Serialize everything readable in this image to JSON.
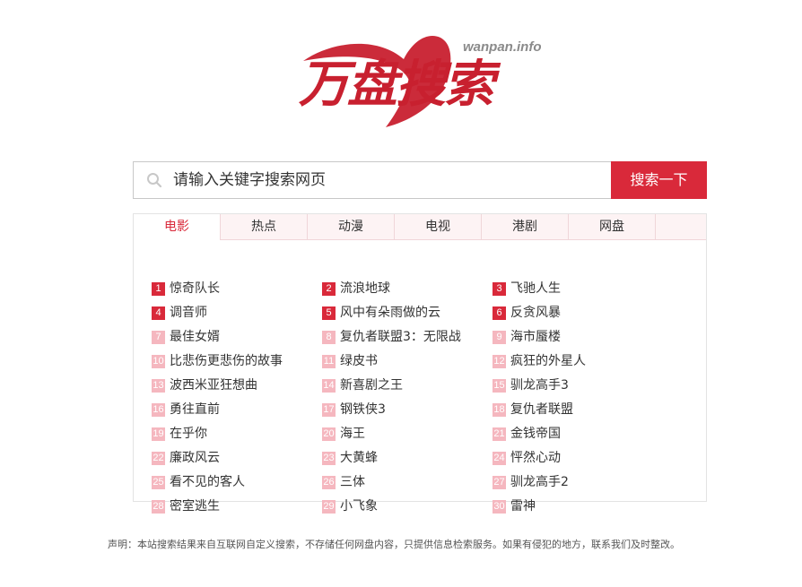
{
  "logo": {
    "domain": "wanpan.info",
    "title": "万盘搜索"
  },
  "search": {
    "placeholder": "请输入关键字搜索网页",
    "button": "搜索一下"
  },
  "tabs": [
    {
      "label": "电影",
      "active": true
    },
    {
      "label": "热点",
      "active": false
    },
    {
      "label": "动漫",
      "active": false
    },
    {
      "label": "电视",
      "active": false
    },
    {
      "label": "港剧",
      "active": false
    },
    {
      "label": "网盘",
      "active": false
    }
  ],
  "items": [
    {
      "rank": "1",
      "title": "惊奇队长"
    },
    {
      "rank": "2",
      "title": "流浪地球"
    },
    {
      "rank": "3",
      "title": "飞驰人生"
    },
    {
      "rank": "4",
      "title": "调音师"
    },
    {
      "rank": "5",
      "title": "风中有朵雨做的云"
    },
    {
      "rank": "6",
      "title": "反贪风暴"
    },
    {
      "rank": "7",
      "title": "最佳女婿"
    },
    {
      "rank": "8",
      "title": "复仇者联盟3：无限战"
    },
    {
      "rank": "9",
      "title": "海市蜃楼"
    },
    {
      "rank": "10",
      "title": "比悲伤更悲伤的故事"
    },
    {
      "rank": "11",
      "title": "绿皮书"
    },
    {
      "rank": "12",
      "title": "疯狂的外星人"
    },
    {
      "rank": "13",
      "title": "波西米亚狂想曲"
    },
    {
      "rank": "14",
      "title": "新喜剧之王"
    },
    {
      "rank": "15",
      "title": "驯龙高手3"
    },
    {
      "rank": "16",
      "title": "勇往直前"
    },
    {
      "rank": "17",
      "title": "钢铁侠3"
    },
    {
      "rank": "18",
      "title": "复仇者联盟"
    },
    {
      "rank": "19",
      "title": "在乎你"
    },
    {
      "rank": "20",
      "title": "海王"
    },
    {
      "rank": "21",
      "title": "金钱帝国"
    },
    {
      "rank": "22",
      "title": "廉政风云"
    },
    {
      "rank": "23",
      "title": "大黄蜂"
    },
    {
      "rank": "24",
      "title": "怦然心动"
    },
    {
      "rank": "25",
      "title": "看不见的客人"
    },
    {
      "rank": "26",
      "title": "三体"
    },
    {
      "rank": "27",
      "title": "驯龙高手2"
    },
    {
      "rank": "28",
      "title": "密室逃生"
    },
    {
      "rank": "29",
      "title": "小飞象"
    },
    {
      "rank": "30",
      "title": "雷神"
    }
  ],
  "notice": "声明：本站搜索结果来自互联网自定义搜索，不存储任何网盘内容，只提供信息检索服务。如果有侵犯的地方，联系我们及时整改。",
  "colors": {
    "accent": "#d9293a",
    "logo": "#c8202f",
    "rank_top": "#d9293a",
    "rank_other": "#f5b7bf"
  }
}
